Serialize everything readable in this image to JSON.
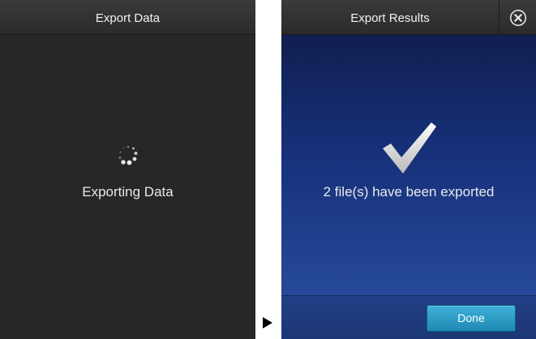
{
  "left_screen": {
    "title": "Export Data",
    "status_text": "Exporting Data",
    "icon": "loading-spinner-icon"
  },
  "right_screen": {
    "title": "Export Results",
    "message": "2 file(s) have been exported",
    "icon": "checkmark-icon",
    "close_icon": "close-icon",
    "done_label": "Done"
  },
  "transition_icon": "play-arrow-icon",
  "colors": {
    "left_background": "#272727",
    "right_background_top": "#0e1a44",
    "right_background_bottom": "#2a52a3",
    "done_button": "#2a9ac6",
    "text": "#e9e9e9"
  }
}
